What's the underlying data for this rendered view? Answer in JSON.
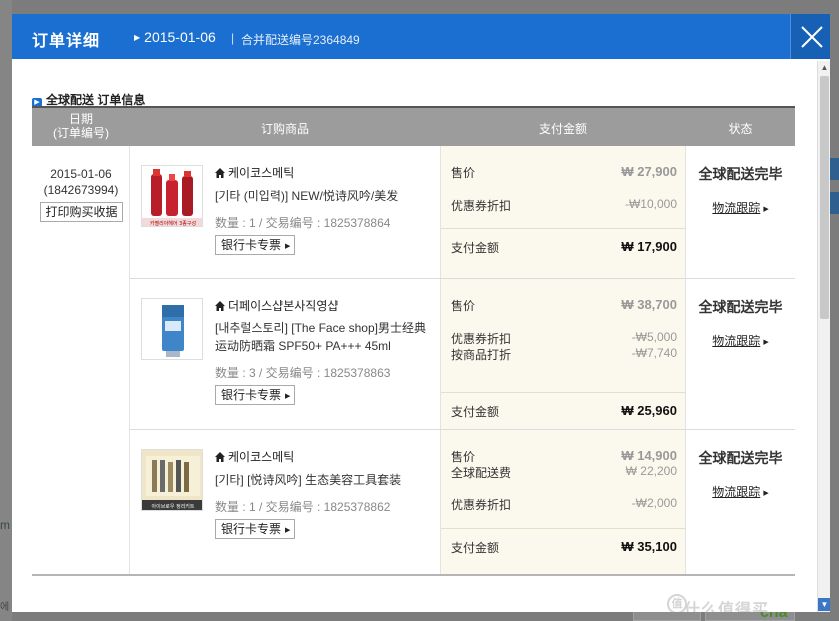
{
  "modal": {
    "title": "订单详细",
    "date": "2015-01-06",
    "merge_label": "合并配送编号2364849"
  },
  "section": {
    "title": "全球配送 订单信息"
  },
  "table": {
    "headers": {
      "date_line1": "日期",
      "date_line2": "(订单编号)",
      "goods": "订购商品",
      "pay": "支付金额",
      "status": "状态"
    }
  },
  "order": {
    "date": "2015-01-06",
    "order_no": "(1842673994)",
    "print_button": "打印购买收据"
  },
  "items": [
    {
      "shop": "케이코스메틱",
      "name": "[기타 (미입력)] NEW/悦诗风吟/美发",
      "meta": "数量 : 1 / 交易编号 : 1825378864",
      "bank_button": "银行卡专票",
      "pay": {
        "price_label": "售价",
        "price": "₩ 27,900",
        "coupon_label": "优惠券折扣",
        "coupon": "-₩10,000",
        "total_label": "支付金额",
        "total": "₩ 17,900"
      },
      "status": "全球配送完毕",
      "track": "物流跟踪",
      "thumb_caption": "카멜리아헤어 3종구성"
    },
    {
      "shop": "더페이스샵본사직영샵",
      "name": "[내추럴스토리] [The Face shop]男士经典运动防晒霜 SPF50+ PA+++ 45ml",
      "meta": "数量 : 3 / 交易编号 : 1825378863",
      "bank_button": "银行卡专票",
      "pay": {
        "price_label": "售价",
        "price": "₩ 38,700",
        "coupon_label": "优惠券折扣",
        "coupon": "-₩5,000",
        "discount_label": "按商品打折",
        "discount": "-₩7,740",
        "total_label": "支付金额",
        "total": "₩ 25,960"
      },
      "status": "全球配送完毕",
      "track": "物流跟踪"
    },
    {
      "shop": "케이코스메틱",
      "name": "[기타] [悦诗风吟] 生态美容工具套装",
      "meta": "数量 : 1 / 交易编号 : 1825378862",
      "bank_button": "银行卡专票",
      "pay": {
        "price_label": "售价",
        "price": "₩ 14,900",
        "shipping_label": "全球配送费",
        "shipping": "₩ 22,200",
        "coupon_label": "优惠券折扣",
        "coupon": "-₩2,000",
        "total_label": "支付金额",
        "total": "₩ 35,100"
      },
      "status": "全球配送完毕",
      "track": "物流跟踪",
      "thumb_caption": "아이브로우 정리키트"
    }
  ],
  "watermark": "什么值得买",
  "watermark_logo": "值",
  "colors": {
    "header_blue": "#1a6fd0",
    "table_header": "#9c9c9c",
    "pay_bg": "#fbf9ee"
  },
  "background": {
    "left_text": "m",
    "left_text2": "에",
    "right_text": "cha"
  }
}
